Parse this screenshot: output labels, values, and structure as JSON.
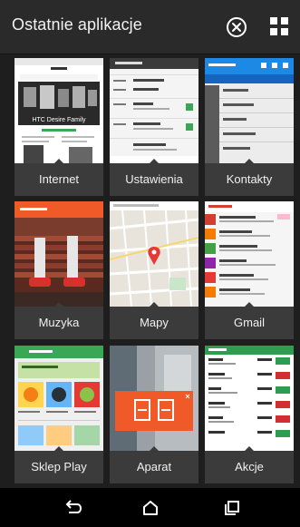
{
  "header": {
    "title": "Ostatnie aplikacje",
    "close_icon": "close-circle-icon",
    "grid_icon": "app-grid-icon"
  },
  "apps": [
    {
      "label": "Internet",
      "thumb": "htc-website-screenshot"
    },
    {
      "label": "Ustawienia",
      "thumb": "settings-screen"
    },
    {
      "label": "Kontakty",
      "thumb": "contacts-list"
    },
    {
      "label": "Muzyka",
      "thumb": "music-album-art"
    },
    {
      "label": "Mapy",
      "thumb": "map-view"
    },
    {
      "label": "Gmail",
      "thumb": "gmail-inbox"
    },
    {
      "label": "Sklep Play",
      "thumb": "play-store"
    },
    {
      "label": "Aparat",
      "thumb": "camera-view"
    },
    {
      "label": "Akcje",
      "thumb": "stocks-list"
    }
  ],
  "thumb_text": {
    "internet_headline": "HTC Desire Family"
  },
  "navbar": {
    "back_icon": "back-icon",
    "home_icon": "home-icon",
    "recents_icon": "recents-icon"
  },
  "colors": {
    "accent_orange": "#f05a28",
    "contacts_blue": "#1e88e5",
    "gmail_red": "#d23f31",
    "stocks_green": "#2e9d4f",
    "play_green": "#3aa757"
  }
}
